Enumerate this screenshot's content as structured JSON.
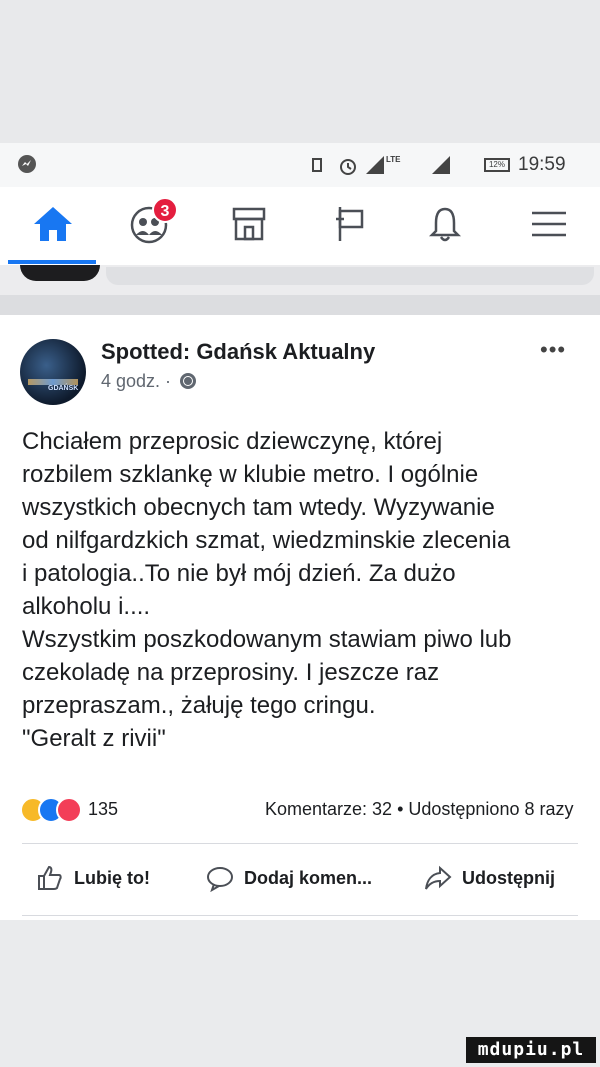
{
  "status_bar": {
    "lte_label": "LTE",
    "battery_label": "12%",
    "time": "19:59"
  },
  "nav": {
    "friends_badge": "3",
    "icons": [
      "home-icon",
      "friends-icon",
      "marketplace-icon",
      "watch-icon",
      "notifications-icon",
      "menu-icon"
    ],
    "active_color": "#1877f2"
  },
  "post": {
    "page_name": "Spotted: Gdańsk Aktualny",
    "time_ago": "4 godz. ·",
    "more_label": "•••",
    "avatar_text": "GDAŃSK",
    "text": "Chciałem przeprosic dziewczynę, której\nrozbilem szklankę w klubie metro. I ogólnie\nwszystkich obecnych tam wtedy. Wyzywanie\nod nilfgardzkich szmat, wiedzminskie zlecenia\ni patologia..To nie był mój dzień. Za dużo\nalkoholu i....\nWszystkim poszkodowanym stawiam piwo lub\nczekoladę  na przeprosiny. I jeszcze  raz\nprzepraszam., żałuję tego cringu.\n\"Geralt z rivii\"",
    "reaction_count": "135",
    "stats": "Komentarze: 32 • Udostępniono 8 razy",
    "actions": {
      "like": "Lubię to!",
      "comment": "Dodaj komen...",
      "share": "Udostępnij"
    }
  },
  "watermark": "mdupiu.pl"
}
